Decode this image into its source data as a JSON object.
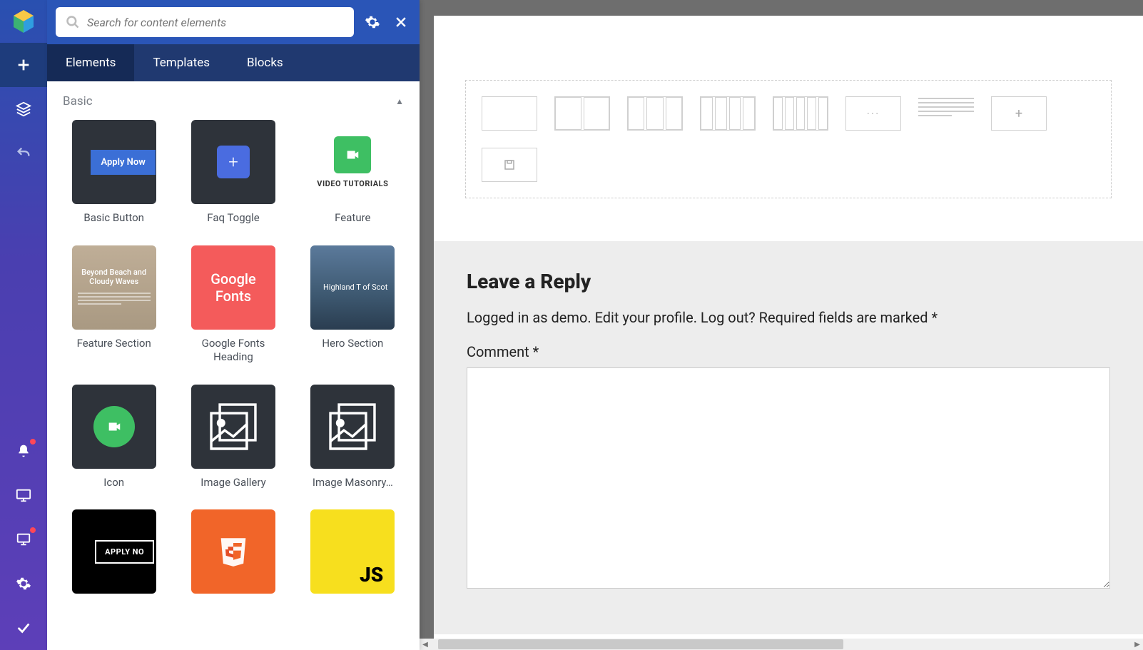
{
  "search": {
    "placeholder": "Search for content elements"
  },
  "tabs": [
    "Elements",
    "Templates",
    "Blocks"
  ],
  "section": {
    "title": "Basic"
  },
  "tiles": [
    {
      "label": "Basic Button",
      "thumb_text": "Apply Now"
    },
    {
      "label": "Faq Toggle"
    },
    {
      "label": "Feature",
      "thumb_caption": "VIDEO TUTORIALS"
    },
    {
      "label": "Feature Section",
      "thumb_heading": "Beyond Beach and Cloudy Waves"
    },
    {
      "label": "Google Fonts Heading",
      "thumb_line1": "Google",
      "thumb_line2": "Fonts"
    },
    {
      "label": "Hero Section",
      "thumb_heading": "Highland T of Scot"
    },
    {
      "label": "Icon"
    },
    {
      "label": "Image Gallery"
    },
    {
      "label": "Image Masonry…"
    },
    {
      "label": "",
      "thumb_text": "APPLY NO"
    },
    {
      "label": ""
    },
    {
      "label": "",
      "thumb_text": "JS"
    }
  ],
  "reply": {
    "heading": "Leave a Reply",
    "meta_pre": "Logged in as ",
    "user": "demo",
    "meta_mid1": ". ",
    "edit": "Edit your profile",
    "meta_mid2": ". ",
    "logout": "Log out?",
    "meta_post": " Required fields are marked *",
    "comment_label": "Comment *"
  }
}
